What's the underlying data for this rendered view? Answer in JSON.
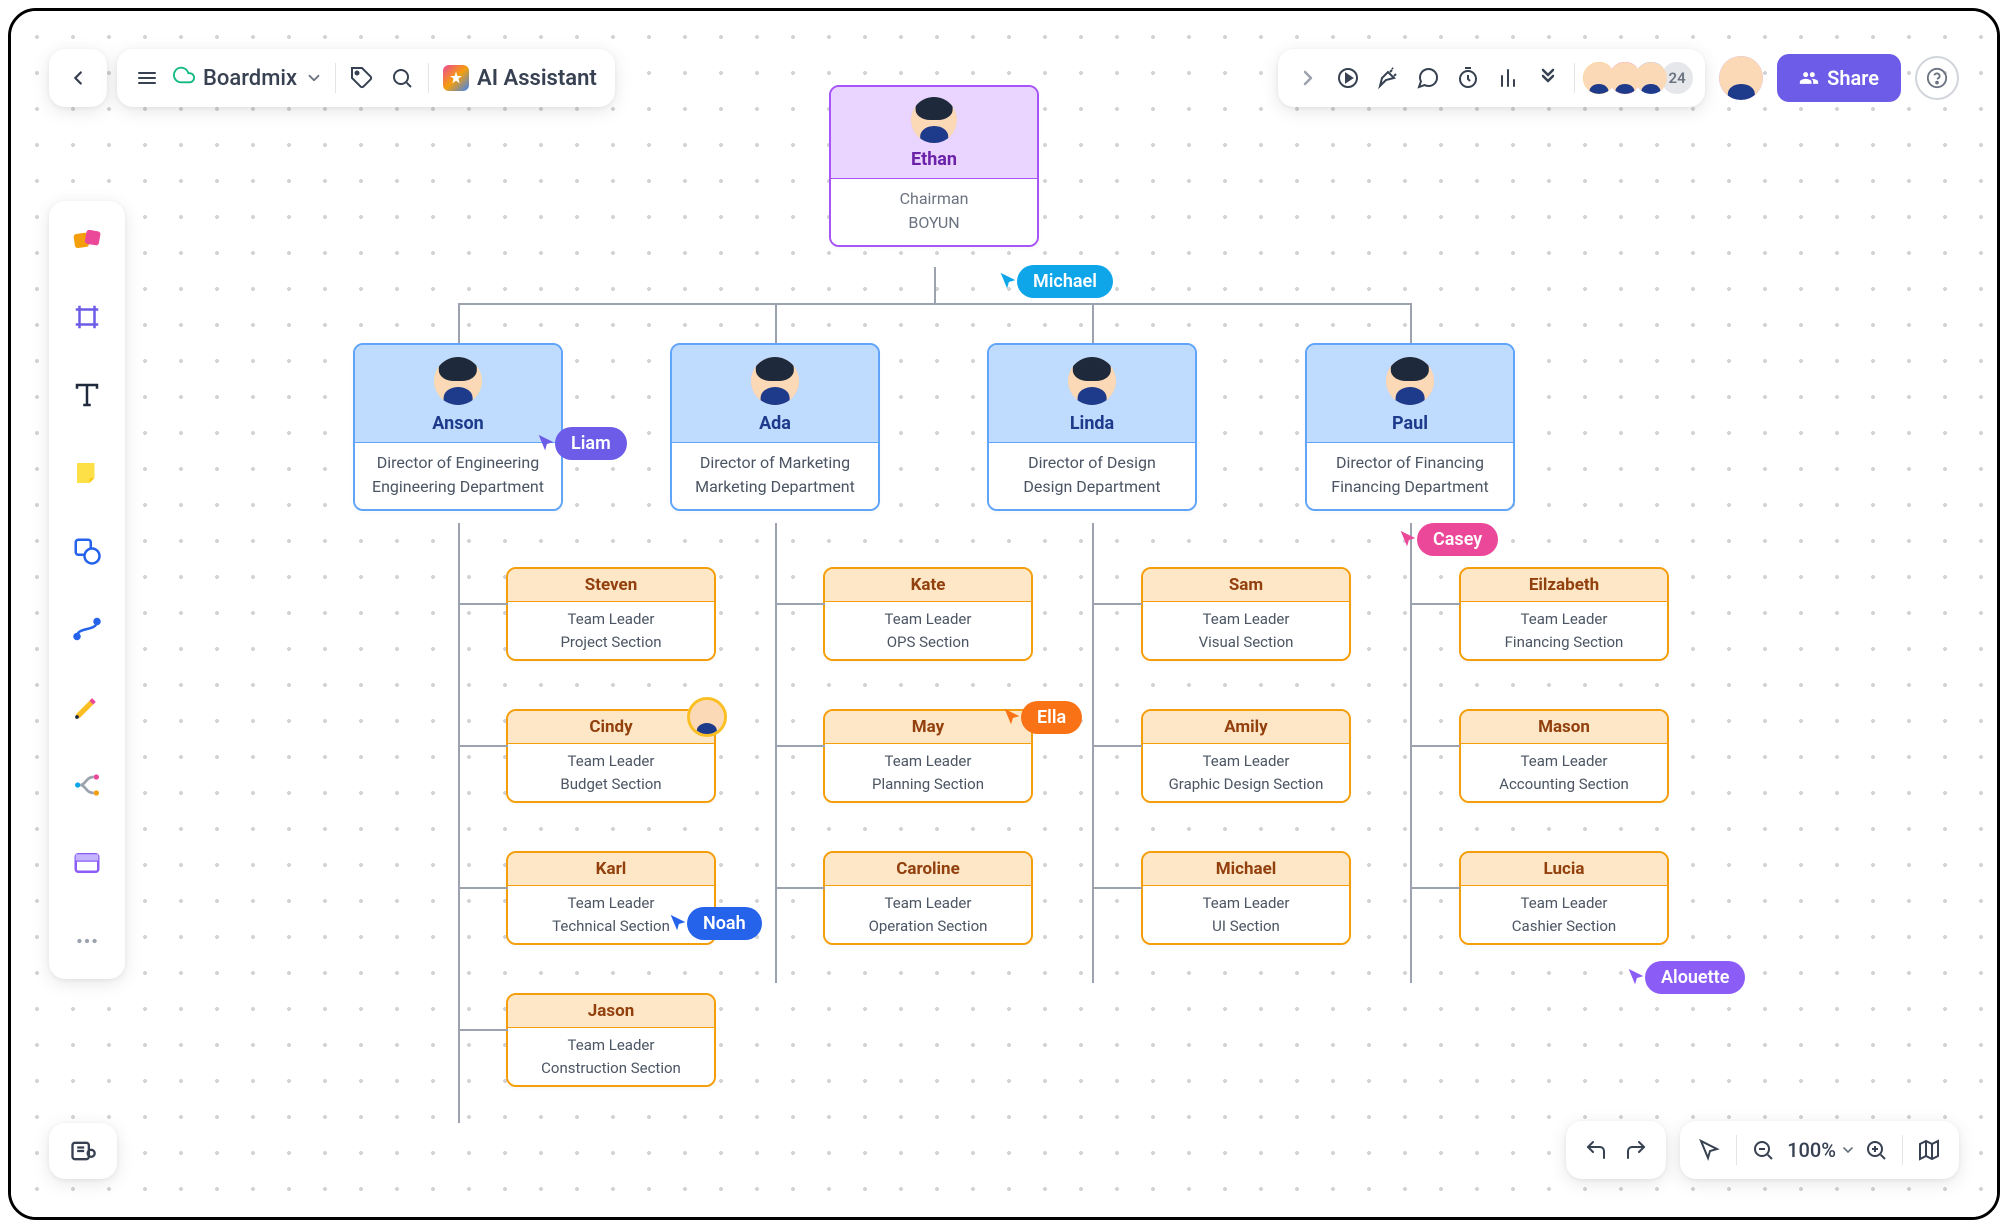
{
  "header": {
    "app_name": "Boardmix",
    "ai_label": "AI Assistant",
    "collaborator_count": "24",
    "share_label": "Share"
  },
  "zoom": {
    "label": "100%"
  },
  "org": {
    "root": {
      "name": "Ethan",
      "title": "Chairman",
      "dept": "BOYUN"
    },
    "l1": [
      {
        "name": "Anson",
        "title": "Director of Engineering",
        "dept": "Engineering Department"
      },
      {
        "name": "Ada",
        "title": "Director of Marketing",
        "dept": "Marketing Department"
      },
      {
        "name": "Linda",
        "title": "Director of Design",
        "dept": "Design Department"
      },
      {
        "name": "Paul",
        "title": "Director of Financing",
        "dept": "Financing Department"
      }
    ],
    "l2": {
      "anson": [
        {
          "name": "Steven",
          "title": "Team Leader",
          "dept": "Project Section"
        },
        {
          "name": "Cindy",
          "title": "Team Leader",
          "dept": "Budget Section"
        },
        {
          "name": "Karl",
          "title": "Team Leader",
          "dept": "Technical Section"
        },
        {
          "name": "Jason",
          "title": "Team Leader",
          "dept": "Construction Section"
        }
      ],
      "ada": [
        {
          "name": "Kate",
          "title": "Team Leader",
          "dept": "OPS Section"
        },
        {
          "name": "May",
          "title": "Team Leader",
          "dept": "Planning Section"
        },
        {
          "name": "Caroline",
          "title": "Team Leader",
          "dept": "Operation Section"
        }
      ],
      "linda": [
        {
          "name": "Sam",
          "title": "Team Leader",
          "dept": "Visual Section"
        },
        {
          "name": "Amily",
          "title": "Team Leader",
          "dept": "Graphic Design Section"
        },
        {
          "name": "Michael",
          "title": "Team Leader",
          "dept": "UI Section"
        }
      ],
      "paul": [
        {
          "name": "Eilzabeth",
          "title": "Team Leader",
          "dept": "Financing Section"
        },
        {
          "name": "Mason",
          "title": "Team Leader",
          "dept": "Accounting Section"
        },
        {
          "name": "Lucia",
          "title": "Team Leader",
          "dept": "Cashier Section"
        }
      ]
    }
  },
  "cursors": {
    "michael": "Michael",
    "liam": "Liam",
    "casey": "Casey",
    "ella": "Ella",
    "noah": "Noah",
    "alouette": "Alouette"
  }
}
